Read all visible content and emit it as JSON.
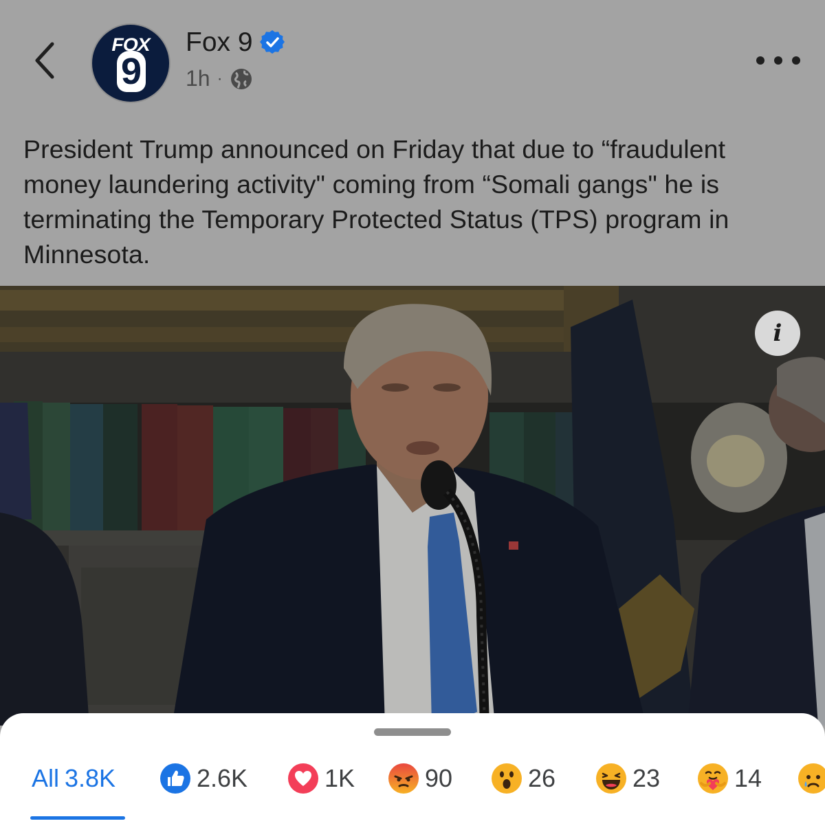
{
  "header": {
    "page_name": "Fox 9",
    "timestamp": "1h",
    "separator": "·",
    "avatar_text_top": "FOX",
    "avatar_text_bottom": "9"
  },
  "post": {
    "caption": "President Trump announced on Friday that due to “fraudulent money laundering activity\" coming from “Somali gangs\" he is terminating the Temporary Protected Status (TPS) program in Minnesota."
  },
  "media": {
    "info_glyph": "i"
  },
  "reactions": {
    "tabs": [
      {
        "label": "All",
        "count": "3.8K",
        "icon": "none",
        "active": true
      },
      {
        "label": "",
        "count": "2.6K",
        "icon": "like-icon"
      },
      {
        "label": "",
        "count": "1K",
        "icon": "love-icon"
      },
      {
        "label": "",
        "count": "90",
        "icon": "angry-icon"
      },
      {
        "label": "",
        "count": "26",
        "icon": "wow-icon"
      },
      {
        "label": "",
        "count": "23",
        "icon": "haha-icon"
      },
      {
        "label": "",
        "count": "14",
        "icon": "care-icon"
      },
      {
        "label": "",
        "count": "",
        "icon": "sad-icon"
      }
    ]
  },
  "colors": {
    "accent": "#1b74e4",
    "overlay_bg": "#a3a3a3",
    "avatar_bg": "#0b1c3d",
    "love": "#f33e58",
    "reaction_yellow": "#f7b125"
  }
}
